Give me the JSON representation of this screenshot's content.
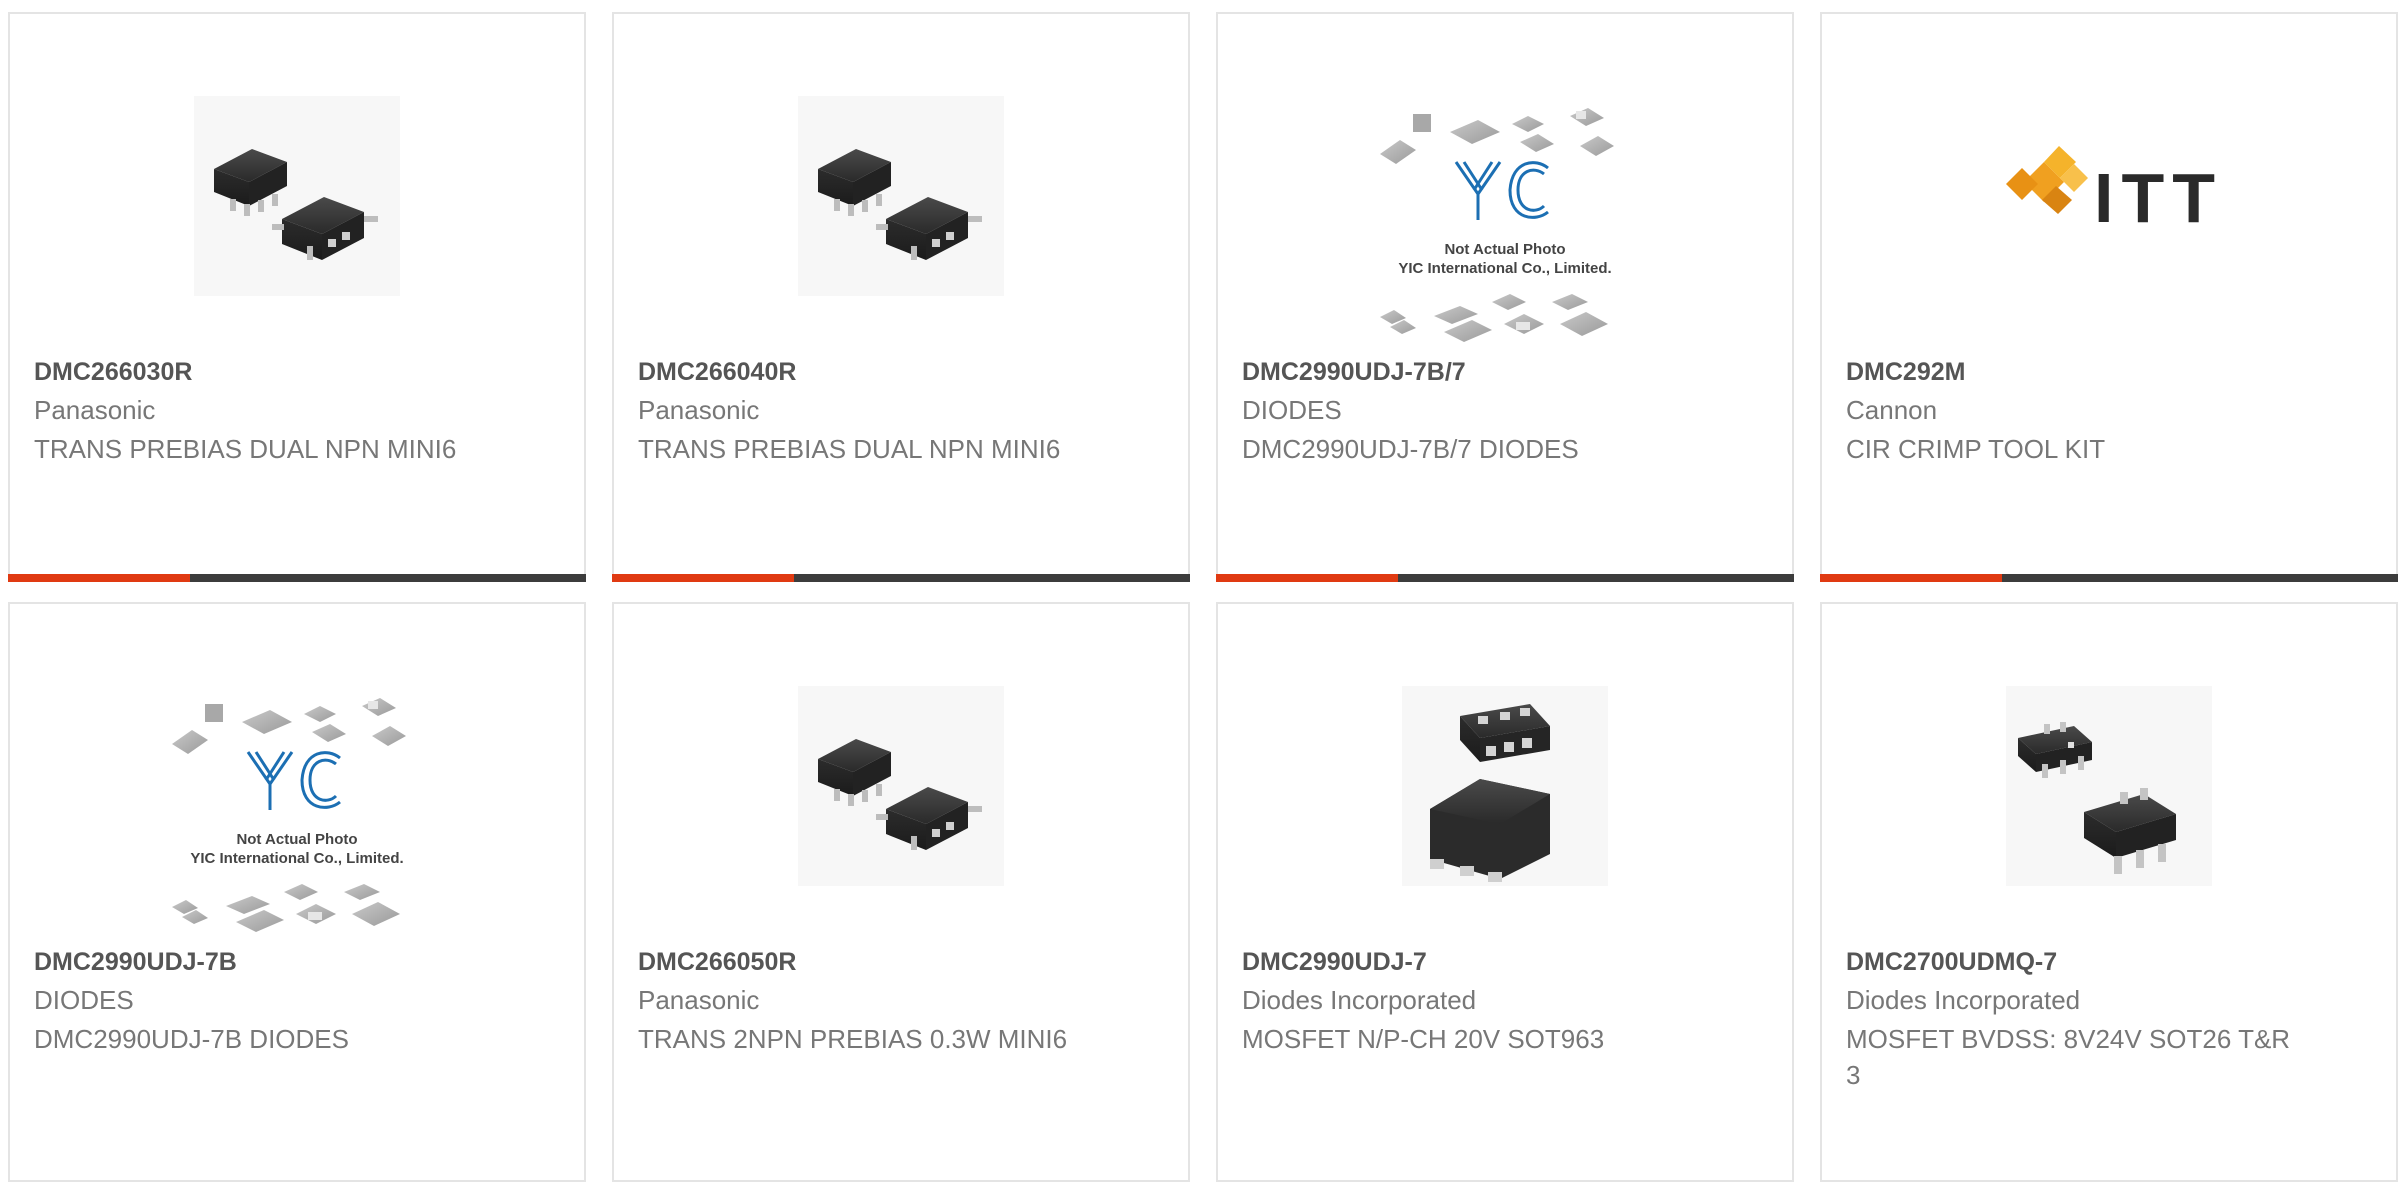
{
  "colors": {
    "accent": "#e03a12",
    "bar_dark": "#3c3c3c",
    "border": "#e4e4e4",
    "part_text": "#555555",
    "meta_text": "#777777"
  },
  "products": [
    {
      "part": "DMC266030R",
      "manufacturer": "Panasonic",
      "description": "TRANS PREBIAS DUAL NPN MINI6",
      "image": "sot-dual-package-photo"
    },
    {
      "part": "DMC266040R",
      "manufacturer": "Panasonic",
      "description": "TRANS PREBIAS DUAL NPN MINI6",
      "image": "sot-dual-package-photo"
    },
    {
      "part": "DMC2990UDJ-7B/7",
      "manufacturer": "DIODES",
      "description": "DMC2990UDJ-7B/7 DIODES",
      "image": "yic-placeholder",
      "image_caption_1": "Not Actual Photo",
      "image_caption_2": "YIC International Co., Limited.",
      "image_logo": "YIC"
    },
    {
      "part": "DMC292M",
      "manufacturer": "Cannon",
      "description": "CIR CRIMP TOOL KIT",
      "image": "itt-logo",
      "image_logo": "ITT"
    },
    {
      "part": "DMC2990UDJ-7B",
      "manufacturer": "DIODES",
      "description": "DMC2990UDJ-7B DIODES",
      "image": "yic-placeholder",
      "image_caption_1": "Not Actual Photo",
      "image_caption_2": "YIC International Co., Limited.",
      "image_logo": "YIC"
    },
    {
      "part": "DMC266050R",
      "manufacturer": "Panasonic",
      "description": "TRANS 2NPN PREBIAS 0.3W MINI6",
      "image": "sot-dual-package-photo"
    },
    {
      "part": "DMC2990UDJ-7",
      "manufacturer": "Diodes Incorporated",
      "description": "MOSFET N/P-CH 20V SOT963",
      "image": "sot963-package-photo"
    },
    {
      "part": "DMC2700UDMQ-7",
      "manufacturer": "Diodes Incorporated",
      "description": "MOSFET BVDSS: 8V24V SOT26 T&R 3",
      "image": "sot26-package-photo"
    }
  ]
}
